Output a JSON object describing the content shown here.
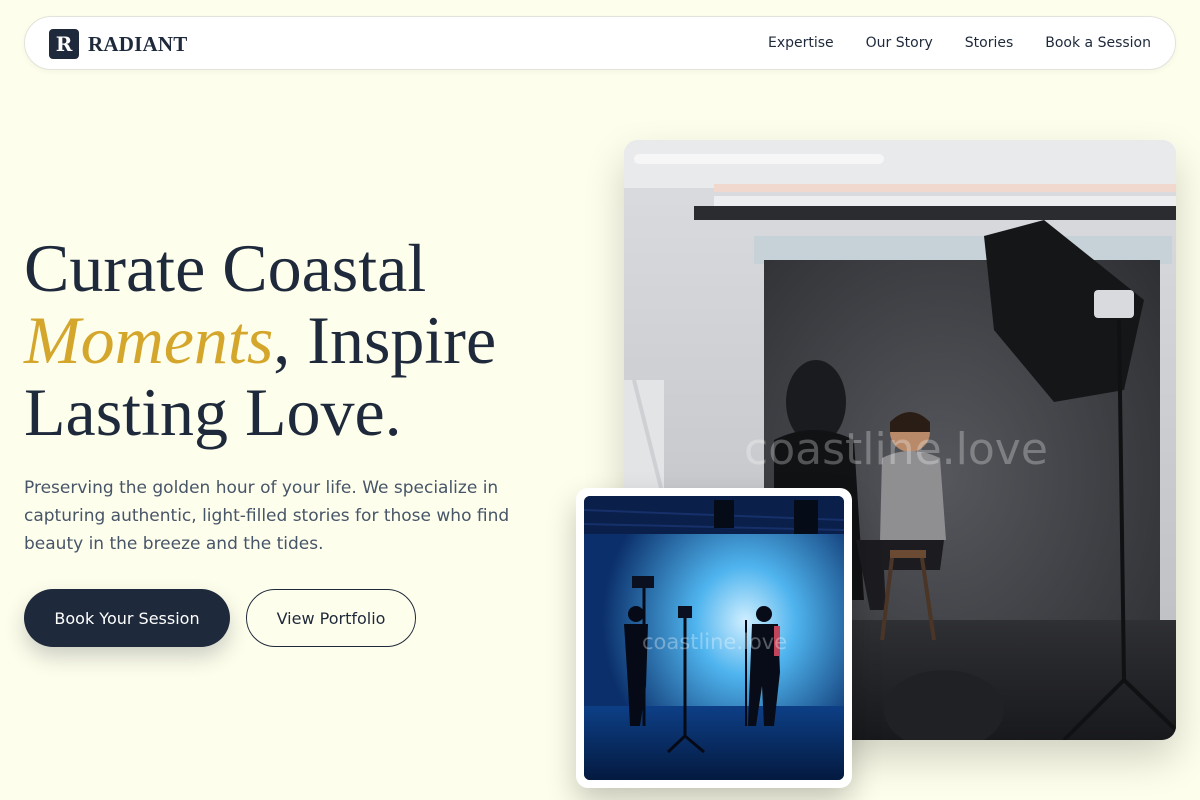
{
  "brand": {
    "mark": "R",
    "name": "RADIANT"
  },
  "nav": {
    "links": [
      "Expertise",
      "Our Story",
      "Stories",
      "Book a Session"
    ]
  },
  "hero": {
    "title_line1": "Curate Coastal",
    "title_accent": "Moments",
    "title_line2_rest": ", Inspire",
    "title_line3": "Lasting Love.",
    "subtitle": "Preserving the golden hour of your life. We specialize in capturing authentic, light-filled stories for those who find beauty in the breeze and the tides.",
    "primary_cta": "Book Your Session",
    "secondary_cta": "View Portfolio"
  },
  "photos": {
    "main_watermark": "coastline.love",
    "small_watermark": "coastline.love"
  },
  "colors": {
    "background": "#fefeec",
    "navy": "#1e293b",
    "gold": "#d4a72c",
    "muted_text": "#475569"
  }
}
